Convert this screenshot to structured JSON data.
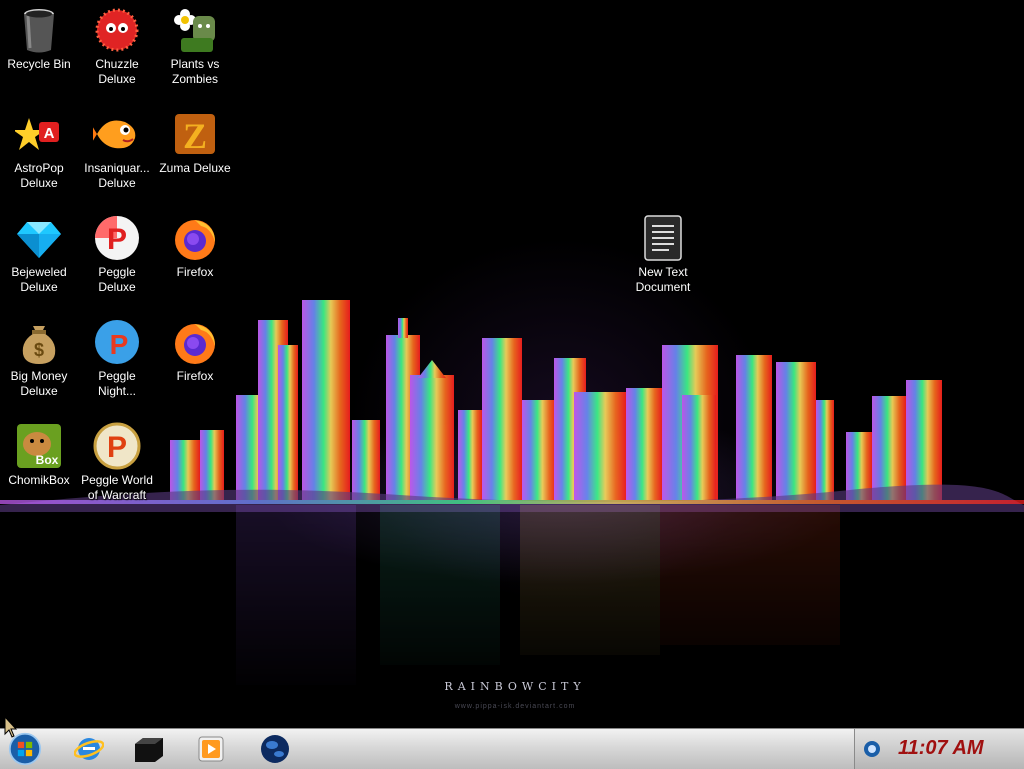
{
  "desktop": {
    "wallpaper": {
      "title": "RAINBOWCITY",
      "credit": "www.pippa-isk.deviantart.com"
    },
    "icons": [
      {
        "label": "Recycle Bin",
        "icon": "recycle-bin-icon"
      },
      {
        "label": "Chuzzle Deluxe",
        "icon": "chuzzle-icon"
      },
      {
        "label": "Plants vs Zombies",
        "icon": "plants-vs-zombies-icon"
      },
      {
        "label": "AstroPop Deluxe",
        "icon": "astropop-icon"
      },
      {
        "label": "Insaniquar... Deluxe",
        "icon": "insaniquarium-icon"
      },
      {
        "label": "Zuma Deluxe",
        "icon": "zuma-icon"
      },
      {
        "label": "Bejeweled Deluxe",
        "icon": "bejeweled-icon"
      },
      {
        "label": "Peggle Deluxe",
        "icon": "peggle-icon"
      },
      {
        "label": "Firefox",
        "icon": "firefox-icon"
      },
      {
        "label": "New Text Document",
        "icon": "text-document-icon"
      },
      {
        "label": "Big Money Deluxe",
        "icon": "big-money-icon"
      },
      {
        "label": "Peggle Night...",
        "icon": "peggle-nights-icon"
      },
      {
        "label": "Firefox",
        "icon": "firefox-icon"
      },
      {
        "label": "ChomikBox",
        "icon": "chomikbox-icon"
      },
      {
        "label": "Peggle World of Warcraft",
        "icon": "peggle-wow-icon"
      }
    ]
  },
  "taskbar": {
    "start": {
      "icon": "windows-start-icon"
    },
    "pinned": [
      {
        "icon": "internet-explorer-icon"
      },
      {
        "icon": "black-box-app-icon"
      },
      {
        "icon": "media-player-icon"
      },
      {
        "icon": "globe-icon"
      }
    ],
    "tray": {
      "icon": "network-tray-icon",
      "clock": "11:07 AM"
    }
  },
  "colors": {
    "clock": "#a01010",
    "taskbar": "#d0d0d0",
    "icon_label": "#ffffff"
  }
}
